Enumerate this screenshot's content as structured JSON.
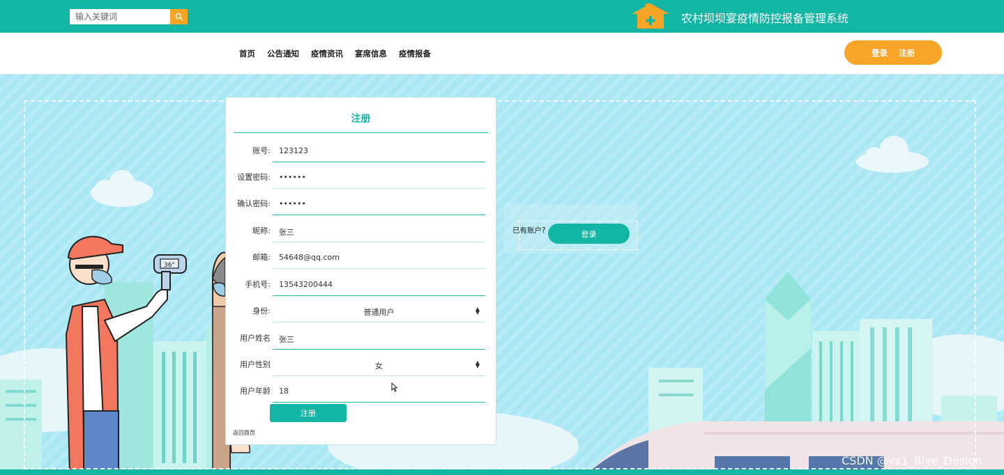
{
  "header": {
    "search_placeholder": "输入关键词",
    "system_title": "农村坝坝宴疫情防控报备管理系统"
  },
  "nav": {
    "items": [
      "首页",
      "公告通知",
      "疫情资讯",
      "宴席信息",
      "疫情报备"
    ],
    "login": "登录",
    "register": "注册"
  },
  "form": {
    "title": "注册",
    "fields": [
      {
        "label": "账号:",
        "value": "123123"
      },
      {
        "label": "设置密码:",
        "value": "••••••"
      },
      {
        "label": "确认密码:",
        "value": "••••••"
      },
      {
        "label": "昵称:",
        "value": "张三"
      },
      {
        "label": "邮箱:",
        "value": "54648@qq.com"
      },
      {
        "label": "手机号:",
        "value": "13543200444"
      },
      {
        "label": "身份:",
        "value": "普通用户"
      },
      {
        "label": "用户姓名",
        "value": "张三"
      },
      {
        "label": "用户性别",
        "value": "女"
      },
      {
        "label": "用户年龄",
        "value": "18"
      }
    ],
    "submit": "注册",
    "home_link": "返回首页"
  },
  "side": {
    "has_account": "已有账户?",
    "login_button": "登录"
  },
  "watermark": "CSDN @vx1_Biye_Design",
  "colors": {
    "primary": "#13b5a5",
    "accent": "#f7a427",
    "sky": "#a9e7f4"
  }
}
